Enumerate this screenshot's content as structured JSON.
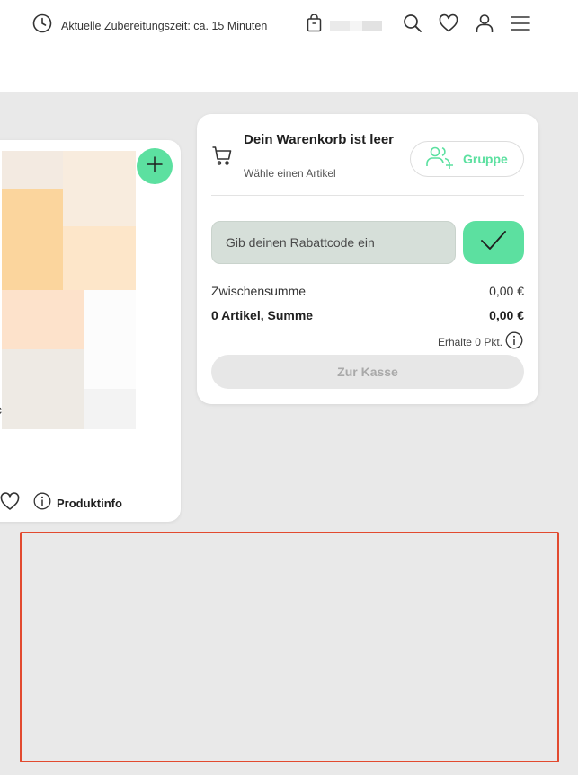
{
  "header": {
    "prep_time": "Aktuelle Zubereitungszeit: ca. 15 Minuten",
    "icons": [
      "clock-icon",
      "shopping-bag-icon",
      "search-icon",
      "heart-icon",
      "user-icon",
      "menu-icon"
    ]
  },
  "product_card": {
    "edge_glyph": "c",
    "add_icon": "plus-icon",
    "product_info_label": "Produktinfo",
    "mosaic_colors": [
      "#f3eae1",
      "#f8ecde",
      "#fbd59d",
      "#fde6c9",
      "#fde2cb",
      "#fcfcfc",
      "#eeeae4",
      "#f3f3f3"
    ]
  },
  "cart": {
    "empty_title": "Dein Warenkorb ist leer",
    "empty_subtitle": "Wähle einen Artikel",
    "group_button": "Gruppe",
    "coupon_placeholder": "Gib deinen Rabattcode ein",
    "subtotal_label": "Zwischensumme",
    "subtotal_value": "0,00 €",
    "total_label": "0 Artikel, Summe",
    "total_value": "0,00 €",
    "points_text": "Erhalte 0 Pkt.",
    "checkout_label": "Zur Kasse"
  },
  "colors": {
    "accent": "#5ce0a0",
    "background": "#e9e9e9",
    "card": "#ffffff",
    "coupon_field": "#d6dfd9",
    "checkout_disabled": "#e7e7e7",
    "highlight_border": "#e24a2f"
  }
}
